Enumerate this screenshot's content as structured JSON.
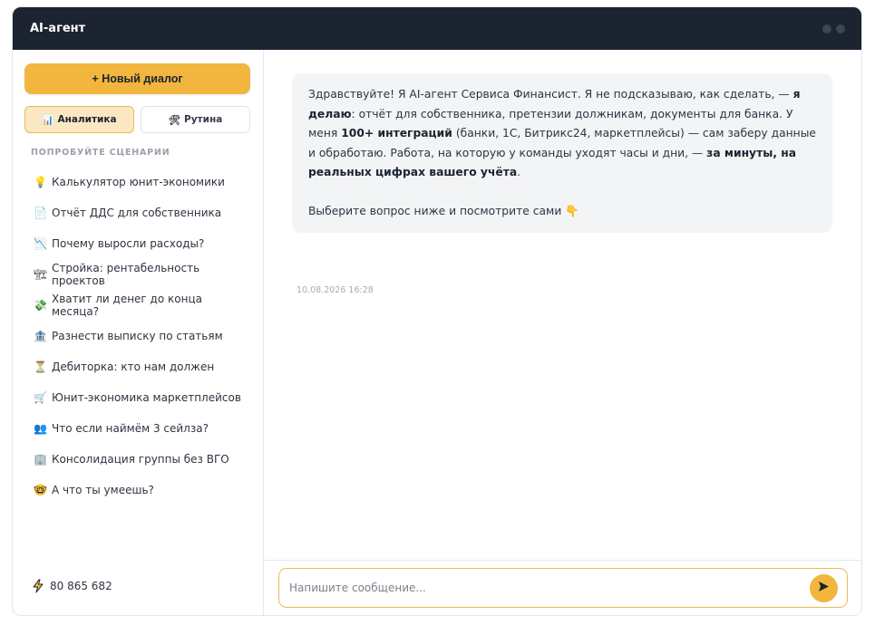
{
  "app": {
    "title": "AI-агент"
  },
  "sidebar": {
    "new_dialog_label": "+ Новый диалог",
    "modes": [
      {
        "icon": "📊",
        "label": "Аналитика",
        "active": true
      },
      {
        "icon": "🛠",
        "label": "Рутина",
        "active": false
      }
    ],
    "section_title": "ПОПРОБУЙТЕ СЦЕНАРИИ",
    "scenarios": [
      {
        "icon": "💡",
        "label": "Калькулятор юнит-экономики"
      },
      {
        "icon": "📄",
        "label": "Отчёт ДДС для собственника"
      },
      {
        "icon": "📉",
        "label": "Почему выросли расходы?"
      },
      {
        "icon": "🏗",
        "label": "Стройка: рентабельность проектов"
      },
      {
        "icon": "💸",
        "label": "Хватит ли денег до конца месяца?"
      },
      {
        "icon": "🏦",
        "label": "Разнести выписку по статьям"
      },
      {
        "icon": "⏳",
        "label": "Дебиторка: кто нам должен"
      },
      {
        "icon": "🛒",
        "label": "Юнит-экономика маркетплейсов"
      },
      {
        "icon": "👥",
        "label": "Что если наймём 3 сейлза?"
      },
      {
        "icon": "🏢",
        "label": "Консолидация группы без ВГО"
      },
      {
        "icon": "🤓",
        "label": "А что ты умеешь?"
      }
    ],
    "phone": "80 865 682"
  },
  "chat": {
    "message": {
      "p1_a": "Здравствуйте! Я AI-агент Сервиса Финансист. Я не подсказываю, как сделать, — ",
      "p1_b": "я делаю",
      "p1_c": ": отчёт для собственника, претензии должникам, документы для банка. У меня ",
      "p1_d": "100+ интеграций",
      "p1_e": " (банки, 1С, Битрикс24, маркетплейсы) — сам заберу данные и обработаю. Работа, на которую у команды уходят часы и дни, — ",
      "p1_f": "за минуты, на реальных цифрах вашего учёта",
      "p1_g": ".",
      "p2": "Выберите вопрос ниже и посмотрите сами 👇"
    },
    "timestamp": "10.08.2026 16:28"
  },
  "composer": {
    "placeholder": "Напишите сообщение..."
  },
  "colors": {
    "accent": "#f2b53d",
    "header": "#1c2331",
    "bubble": "#f2f4f6"
  }
}
